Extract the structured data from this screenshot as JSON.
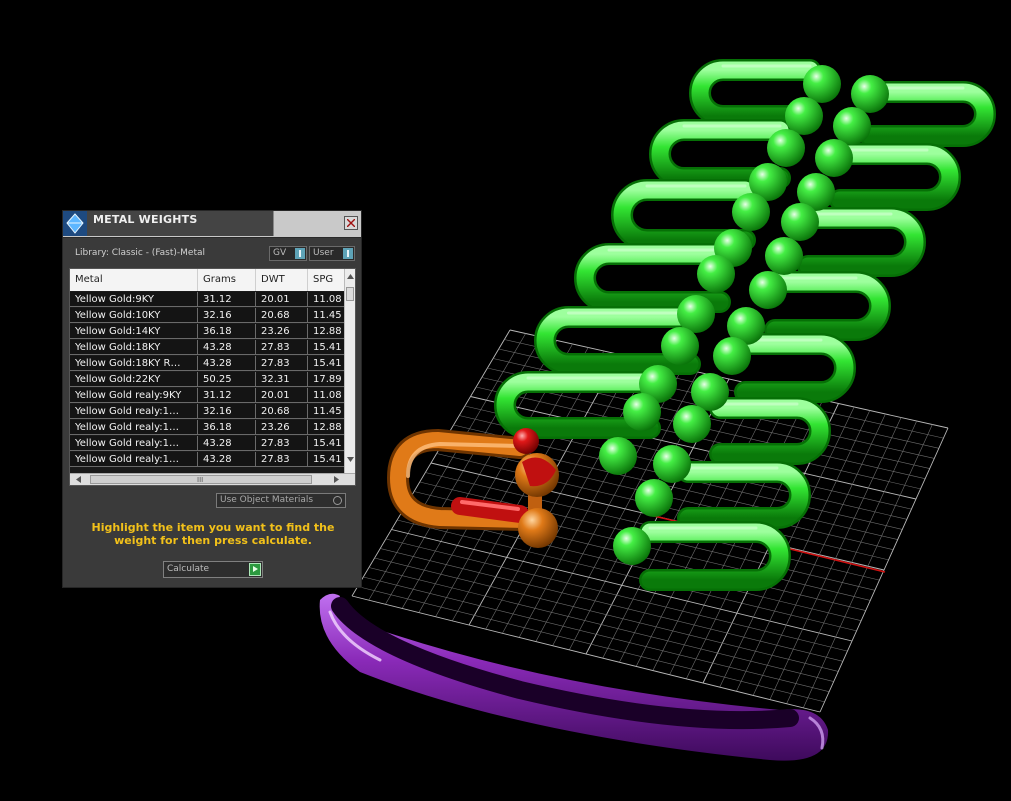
{
  "panel": {
    "title": "METAL WEIGHTS",
    "library_label": "Library: Classic - (Fast)-Metal",
    "gv_label": "GV",
    "user_label": "User",
    "columns": [
      "Metal",
      "Grams",
      "DWT",
      "SPG"
    ],
    "rows": [
      {
        "metal": "Yellow Gold:9KY",
        "grams": "31.12",
        "dwt": "20.01",
        "spg": "11.08"
      },
      {
        "metal": "Yellow Gold:10KY",
        "grams": "32.16",
        "dwt": "20.68",
        "spg": "11.45"
      },
      {
        "metal": "Yellow Gold:14KY",
        "grams": "36.18",
        "dwt": "23.26",
        "spg": "12.88"
      },
      {
        "metal": "Yellow Gold:18KY",
        "grams": "43.28",
        "dwt": "27.83",
        "spg": "15.41"
      },
      {
        "metal": "Yellow Gold:18KY R…",
        "grams": "43.28",
        "dwt": "27.83",
        "spg": "15.41"
      },
      {
        "metal": "Yellow Gold:22KY",
        "grams": "50.25",
        "dwt": "32.31",
        "spg": "17.89"
      },
      {
        "metal": "Yellow Gold realy:9KY",
        "grams": "31.12",
        "dwt": "20.01",
        "spg": "11.08"
      },
      {
        "metal": "Yellow Gold realy:1…",
        "grams": "32.16",
        "dwt": "20.68",
        "spg": "11.45"
      },
      {
        "metal": "Yellow Gold realy:1…",
        "grams": "36.18",
        "dwt": "23.26",
        "spg": "12.88"
      },
      {
        "metal": "Yellow Gold realy:1…",
        "grams": "43.28",
        "dwt": "27.83",
        "spg": "15.41"
      },
      {
        "metal": "Yellow Gold realy:1…",
        "grams": "43.28",
        "dwt": "27.83",
        "spg": "15.41"
      }
    ],
    "scroll_grip": "III",
    "use_object_materials": "Use Object Materials",
    "hint": "Highlight the item you want to find the weight for then press calculate.",
    "calculate_label": "Calculate"
  },
  "colors": {
    "background": "#000000",
    "grid": "#9a9a9a",
    "axis_red": "#d01010",
    "chain_green": "#22cc22",
    "clasp_orange": "#d06a10",
    "ring_purple": "#8a2ab8",
    "hint_yellow": "#f2c11a"
  }
}
